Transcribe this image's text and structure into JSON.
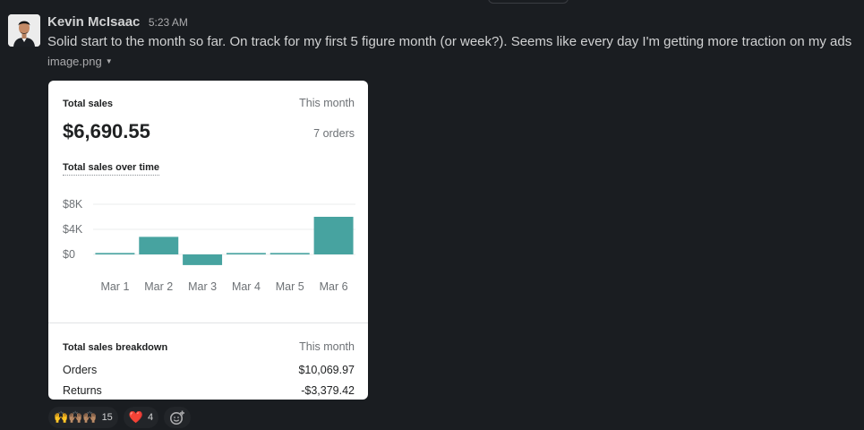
{
  "message": {
    "author": "Kevin McIsaac",
    "time": "5:23 AM",
    "text": "Solid start to the month so far. On track for my first 5 figure month (or week?). Seems like every day I'm getting more traction on my ads",
    "attachment_name": "image.png"
  },
  "card": {
    "total_sales_label": "Total sales",
    "period": "This month",
    "total_value": "$6,690.55",
    "orders_count": "7 orders",
    "chart_title": "Total sales over time",
    "breakdown_title": "Total sales breakdown",
    "breakdown_period": "This month",
    "rows": [
      {
        "label": "Orders",
        "value": "$10,069.97"
      },
      {
        "label": "Returns",
        "value": "-$3,379.42"
      }
    ]
  },
  "chart_data": {
    "type": "bar",
    "categories": [
      "Mar 1",
      "Mar 2",
      "Mar 3",
      "Mar 4",
      "Mar 5",
      "Mar 6"
    ],
    "values": [
      150,
      2800,
      -1700,
      150,
      150,
      6000
    ],
    "y_ticks": [
      "$8K",
      "$4K",
      "$0"
    ],
    "ylim": [
      -2000,
      8000
    ],
    "color": "#47a3a0",
    "grid": true
  },
  "reactions": [
    {
      "emoji": "🙌🙌🏽🙌🏽",
      "count": "15"
    },
    {
      "emoji": "❤️",
      "count": "4"
    }
  ],
  "colors": {
    "background": "#1a1d21",
    "text": "#d1d2d3",
    "bar": "#47a3a0"
  }
}
